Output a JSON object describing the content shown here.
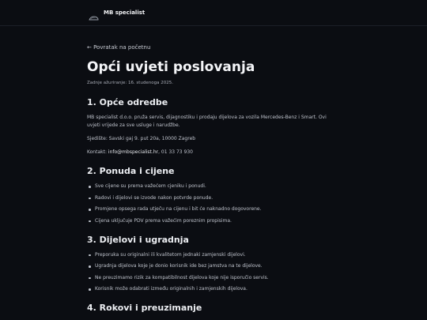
{
  "header": {
    "brand": "MB specialist",
    "logo_icon": "car-silhouette-icon"
  },
  "page": {
    "back_link": "← Povratak na početnu",
    "title": "Opći uvjeti poslovanja",
    "updated": "Zadnje ažuriranje: 16. studenoga 2025."
  },
  "sections": [
    {
      "heading": "1. Opće odredbe",
      "paragraphs": [
        "MB specialist d.o.o. pruža servis, dijagnostiku i prodaju dijelova za vozila Mercedes-Benz i Smart. Ovi uvjeti vrijede za sve usluge i narudžbe.",
        "Sjedište: Savski gaj 9. put 20a, 10000 Zagreb"
      ],
      "contact_label": "Kontakt:",
      "contact_email": "info@mbspecialist.hr",
      "contact_phone": ", 01 33 73 930"
    },
    {
      "heading": "2. Ponuda i cijene",
      "items": [
        "Sve cijene su prema važećem cjeniku i ponudi.",
        "Radovi i dijelovi se izvode nakon potvrde ponude.",
        "Promjene opsega rada utječu na cijenu i bit će naknadno dogovorene.",
        "Cijena uključuje PDV prema važećim poreznim propisima."
      ]
    },
    {
      "heading": "3. Dijelovi i ugradnja",
      "items": [
        "Preporuka su originalni ili kvalitetom jednaki zamjenski dijelovi.",
        "Ugradnja dijelova koje je donio korisnik ide bez jamstva na te dijelove.",
        "Ne preuzimamo rizik za kompatibilnost dijelova koje nije isporučio servis.",
        "Korisnik može odabrati između originalnih i zamjenskih dijelova."
      ]
    },
    {
      "heading": "4. Rokovi i preuzimanje"
    }
  ]
}
